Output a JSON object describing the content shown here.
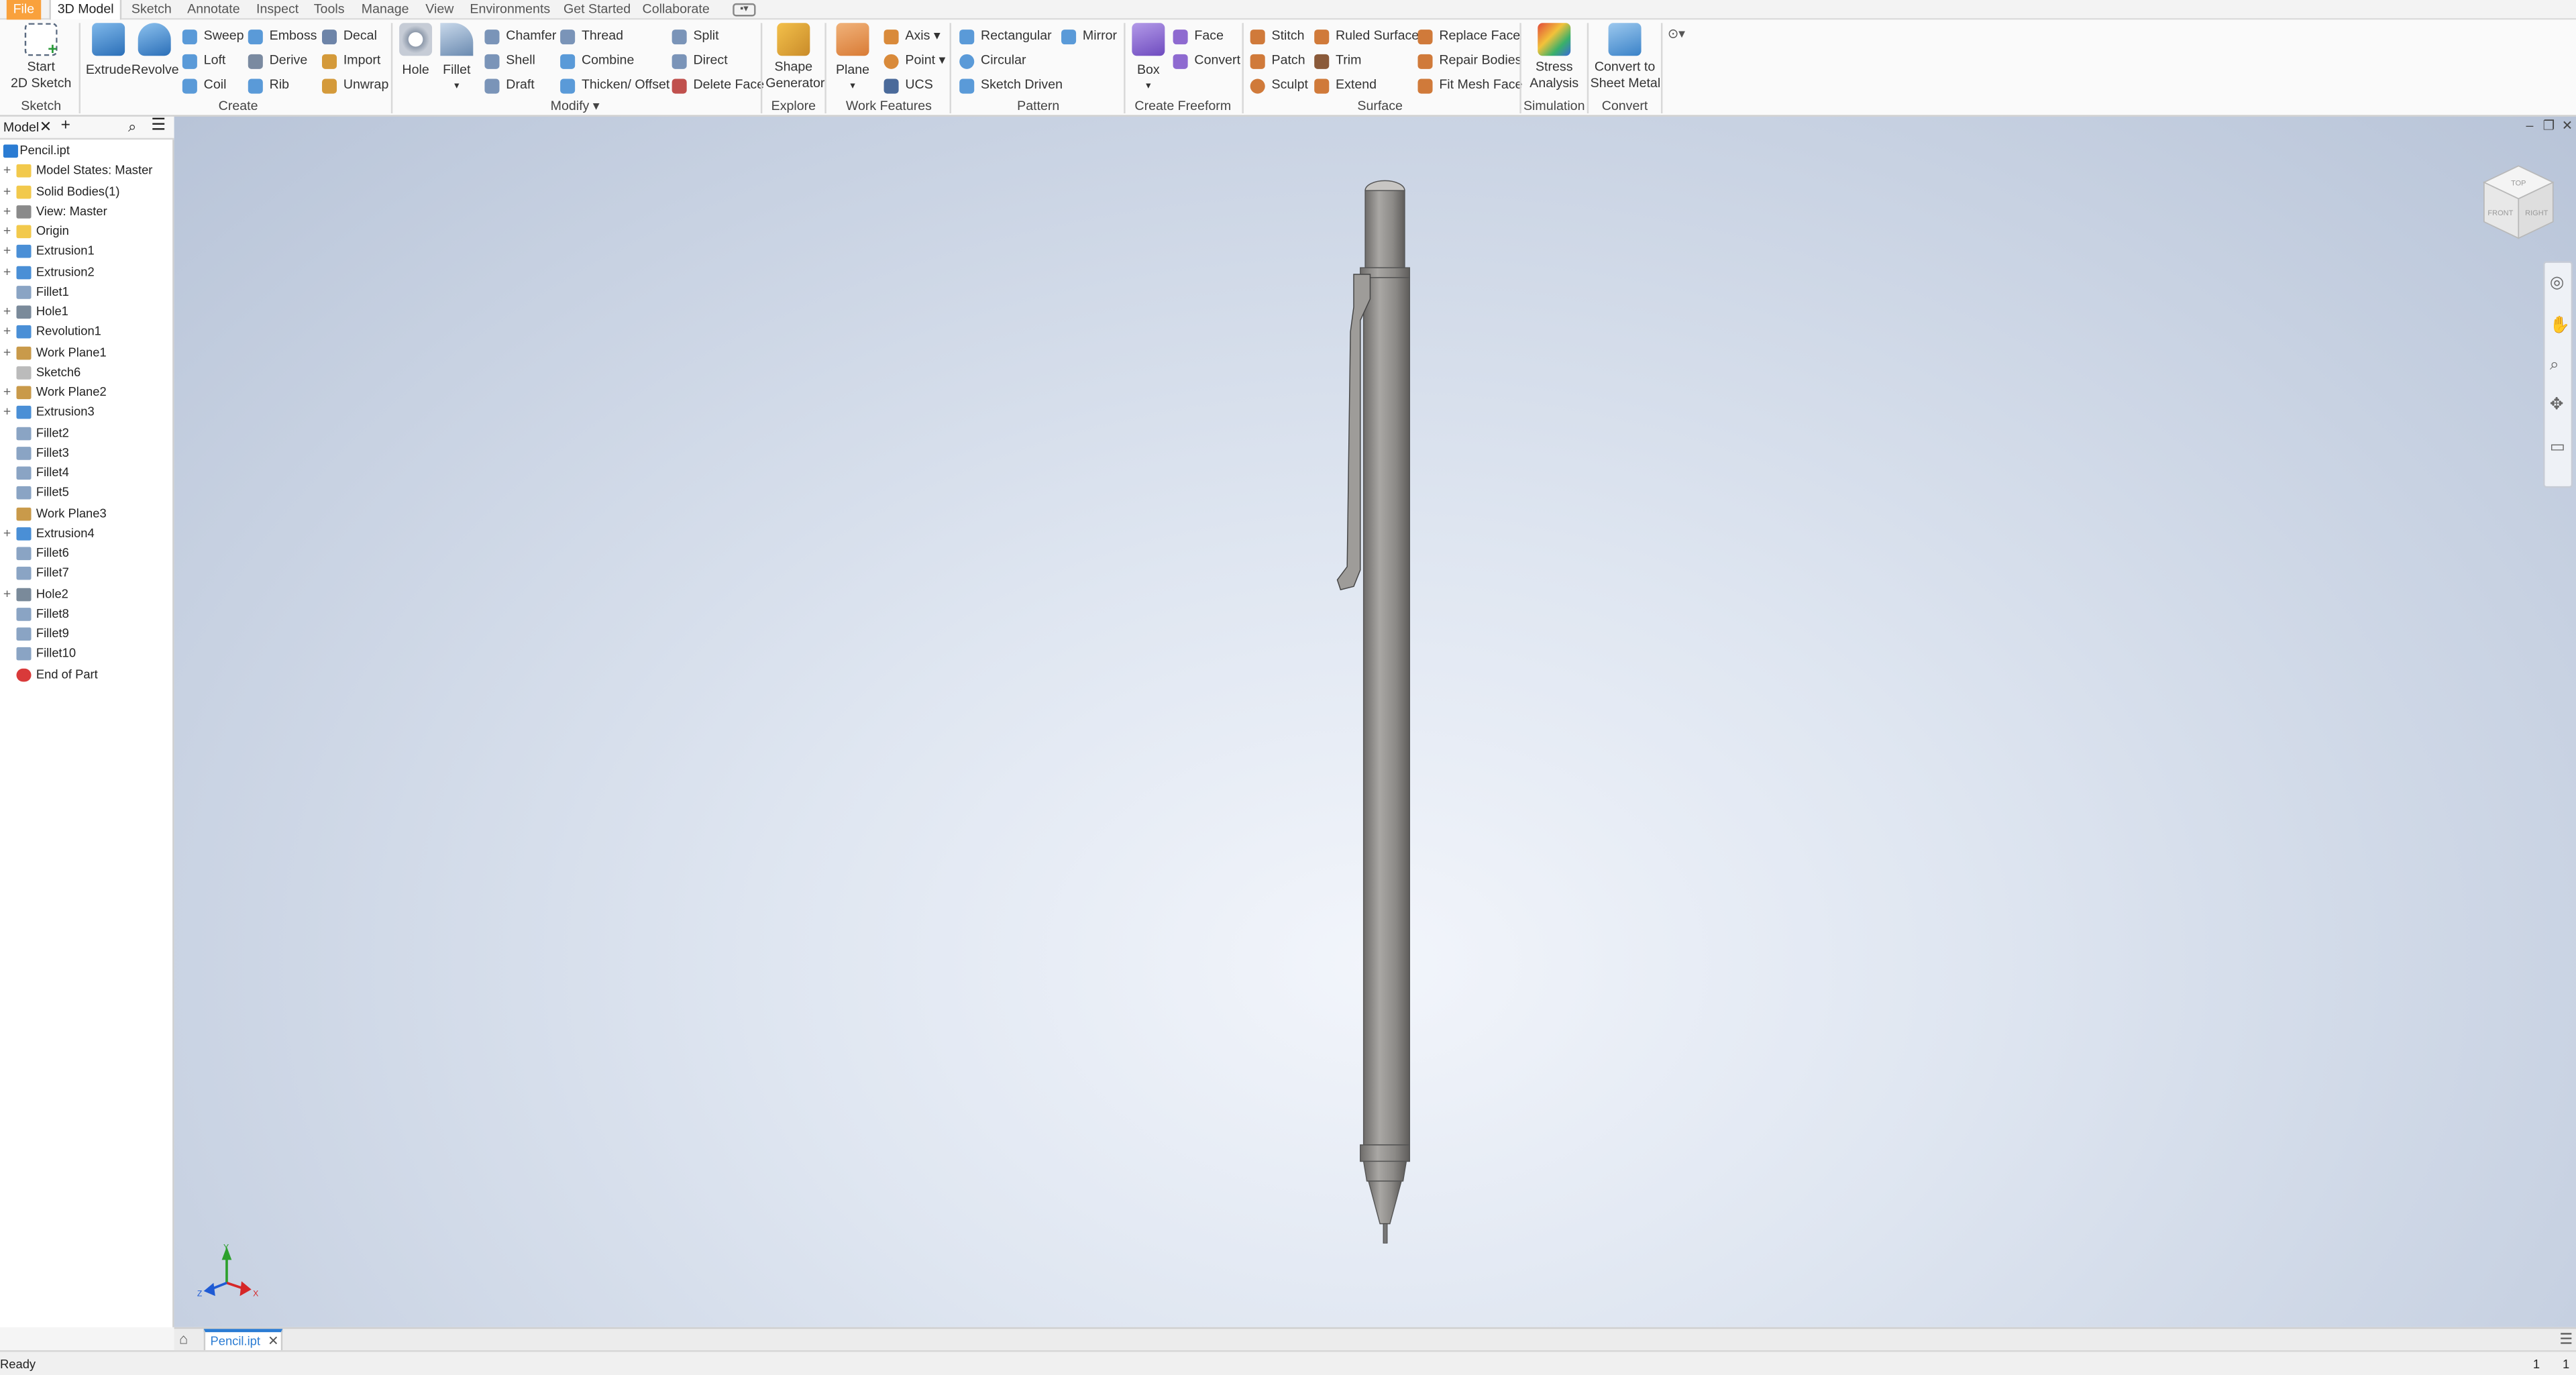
{
  "menu": {
    "tabs": [
      "File",
      "3D Model",
      "Sketch",
      "Annotate",
      "Inspect",
      "Tools",
      "Manage",
      "View",
      "Environments",
      "Get Started",
      "Collaborate"
    ]
  },
  "ribbon": {
    "sketch": {
      "start_label_1": "Start",
      "start_label_2": "2D Sketch",
      "panel": "Sketch"
    },
    "create": {
      "extrude": "Extrude",
      "revolve": "Revolve",
      "sweep": "Sweep",
      "emboss": "Emboss",
      "decal": "Decal",
      "loft": "Loft",
      "derive": "Derive",
      "import": "Import",
      "coil": "Coil",
      "rib": "Rib",
      "unwrap": "Unwrap",
      "panel": "Create"
    },
    "modify": {
      "hole": "Hole",
      "fillet": "Fillet",
      "chamfer": "Chamfer",
      "thread": "Thread",
      "split": "Split",
      "shell": "Shell",
      "combine": "Combine",
      "direct": "Direct",
      "draft": "Draft",
      "thicken": "Thicken/ Offset",
      "delete_face": "Delete Face",
      "panel": "Modify"
    },
    "explore": {
      "shape_gen_1": "Shape",
      "shape_gen_2": "Generator",
      "panel": "Explore"
    },
    "work_features": {
      "plane": "Plane",
      "axis": "Axis",
      "point": "Point",
      "ucs": "UCS",
      "panel": "Work Features"
    },
    "pattern": {
      "rectangular": "Rectangular",
      "mirror": "Mirror",
      "circular": "Circular",
      "sketch_driven": "Sketch Driven",
      "panel": "Pattern"
    },
    "freeform": {
      "box": "Box",
      "face": "Face",
      "convert": "Convert",
      "panel": "Create Freeform"
    },
    "surface": {
      "stitch": "Stitch",
      "ruled_surface": "Ruled Surface",
      "replace_face": "Replace Face",
      "patch": "Patch",
      "trim": "Trim",
      "repair_bodies": "Repair Bodies",
      "sculpt": "Sculpt",
      "extend": "Extend",
      "fit_mesh_face": "Fit Mesh Face",
      "panel": "Surface"
    },
    "simulation": {
      "stress_1": "Stress",
      "stress_2": "Analysis",
      "panel": "Simulation"
    },
    "convert": {
      "sheet_1": "Convert to",
      "sheet_2": "Sheet Metal",
      "panel": "Convert"
    }
  },
  "browser": {
    "tab_label": "Model",
    "items": [
      {
        "label": "Pencil.ipt",
        "icon": "part-icon",
        "expand": ""
      },
      {
        "label": "Model States: Master",
        "icon": "folder-icon",
        "expand": "+"
      },
      {
        "label": "Solid Bodies(1)",
        "icon": "folder-icon",
        "expand": "+"
      },
      {
        "label": "View: Master",
        "icon": "view-icon",
        "expand": "+"
      },
      {
        "label": "Origin",
        "icon": "folder-icon",
        "expand": "+"
      },
      {
        "label": "Extrusion1",
        "icon": "extrude-icon",
        "expand": "+"
      },
      {
        "label": "Extrusion2",
        "icon": "extrude-icon",
        "expand": "+"
      },
      {
        "label": "Fillet1",
        "icon": "fillet-icon",
        "expand": ""
      },
      {
        "label": "Hole1",
        "icon": "hole-icon",
        "expand": "+"
      },
      {
        "label": "Revolution1",
        "icon": "revolve-icon",
        "expand": "+"
      },
      {
        "label": "Work Plane1",
        "icon": "plane-icon",
        "expand": "+"
      },
      {
        "label": "Sketch6",
        "icon": "sketch-icon",
        "expand": ""
      },
      {
        "label": "Work Plane2",
        "icon": "plane-icon",
        "expand": "+"
      },
      {
        "label": "Extrusion3",
        "icon": "extrude-icon",
        "expand": "+"
      },
      {
        "label": "Fillet2",
        "icon": "fillet-icon",
        "expand": ""
      },
      {
        "label": "Fillet3",
        "icon": "fillet-icon",
        "expand": ""
      },
      {
        "label": "Fillet4",
        "icon": "fillet-icon",
        "expand": ""
      },
      {
        "label": "Fillet5",
        "icon": "fillet-icon",
        "expand": ""
      },
      {
        "label": "Work Plane3",
        "icon": "plane-icon",
        "expand": ""
      },
      {
        "label": "Extrusion4",
        "icon": "extrude-icon",
        "expand": "+"
      },
      {
        "label": "Fillet6",
        "icon": "fillet-icon",
        "expand": ""
      },
      {
        "label": "Fillet7",
        "icon": "fillet-icon",
        "expand": ""
      },
      {
        "label": "Hole2",
        "icon": "hole-icon",
        "expand": "+"
      },
      {
        "label": "Fillet8",
        "icon": "fillet-icon",
        "expand": ""
      },
      {
        "label": "Fillet9",
        "icon": "fillet-icon",
        "expand": ""
      },
      {
        "label": "Fillet10",
        "icon": "fillet-icon",
        "expand": ""
      },
      {
        "label": "End of Part",
        "icon": "end-of-part-icon",
        "expand": ""
      }
    ]
  },
  "viewcube": {
    "top": "TOP",
    "front": "FRONT",
    "right": "RIGHT"
  },
  "triad": {
    "x": "X",
    "y": "Y",
    "z": "Z"
  },
  "doc_tab": {
    "label": "Pencil.ipt"
  },
  "status": {
    "text": "Ready",
    "right_1": "1",
    "right_2": "1"
  },
  "colors": {
    "file_tab": "#f9a13c",
    "accent": "#2b7cd3",
    "part_body": "#9a9895"
  }
}
